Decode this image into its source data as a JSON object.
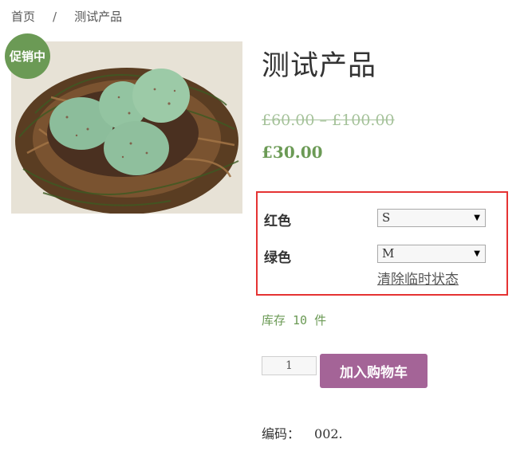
{
  "breadcrumb": {
    "home": "首页",
    "separator": "/",
    "current": "测试产品"
  },
  "badge": {
    "label": "促销中"
  },
  "product": {
    "title": "测试产品",
    "old_price": "£60.00 – £100.00",
    "price": "£30.00"
  },
  "variations": {
    "color_red": {
      "label": "红色",
      "selected": "S"
    },
    "color_green": {
      "label": "绿色",
      "selected": "M"
    },
    "reset": "清除临时状态"
  },
  "stock": "库存 10 件",
  "cart": {
    "qty": "1",
    "button": "加入购物车"
  },
  "sku": {
    "label": "编码：",
    "value": "002."
  },
  "colors": {
    "accent_green": "#6b9a55",
    "button_purple": "#a46497",
    "highlight_red": "#e53333"
  },
  "icons": {
    "dropdown": "dropdown-arrow-icon"
  }
}
